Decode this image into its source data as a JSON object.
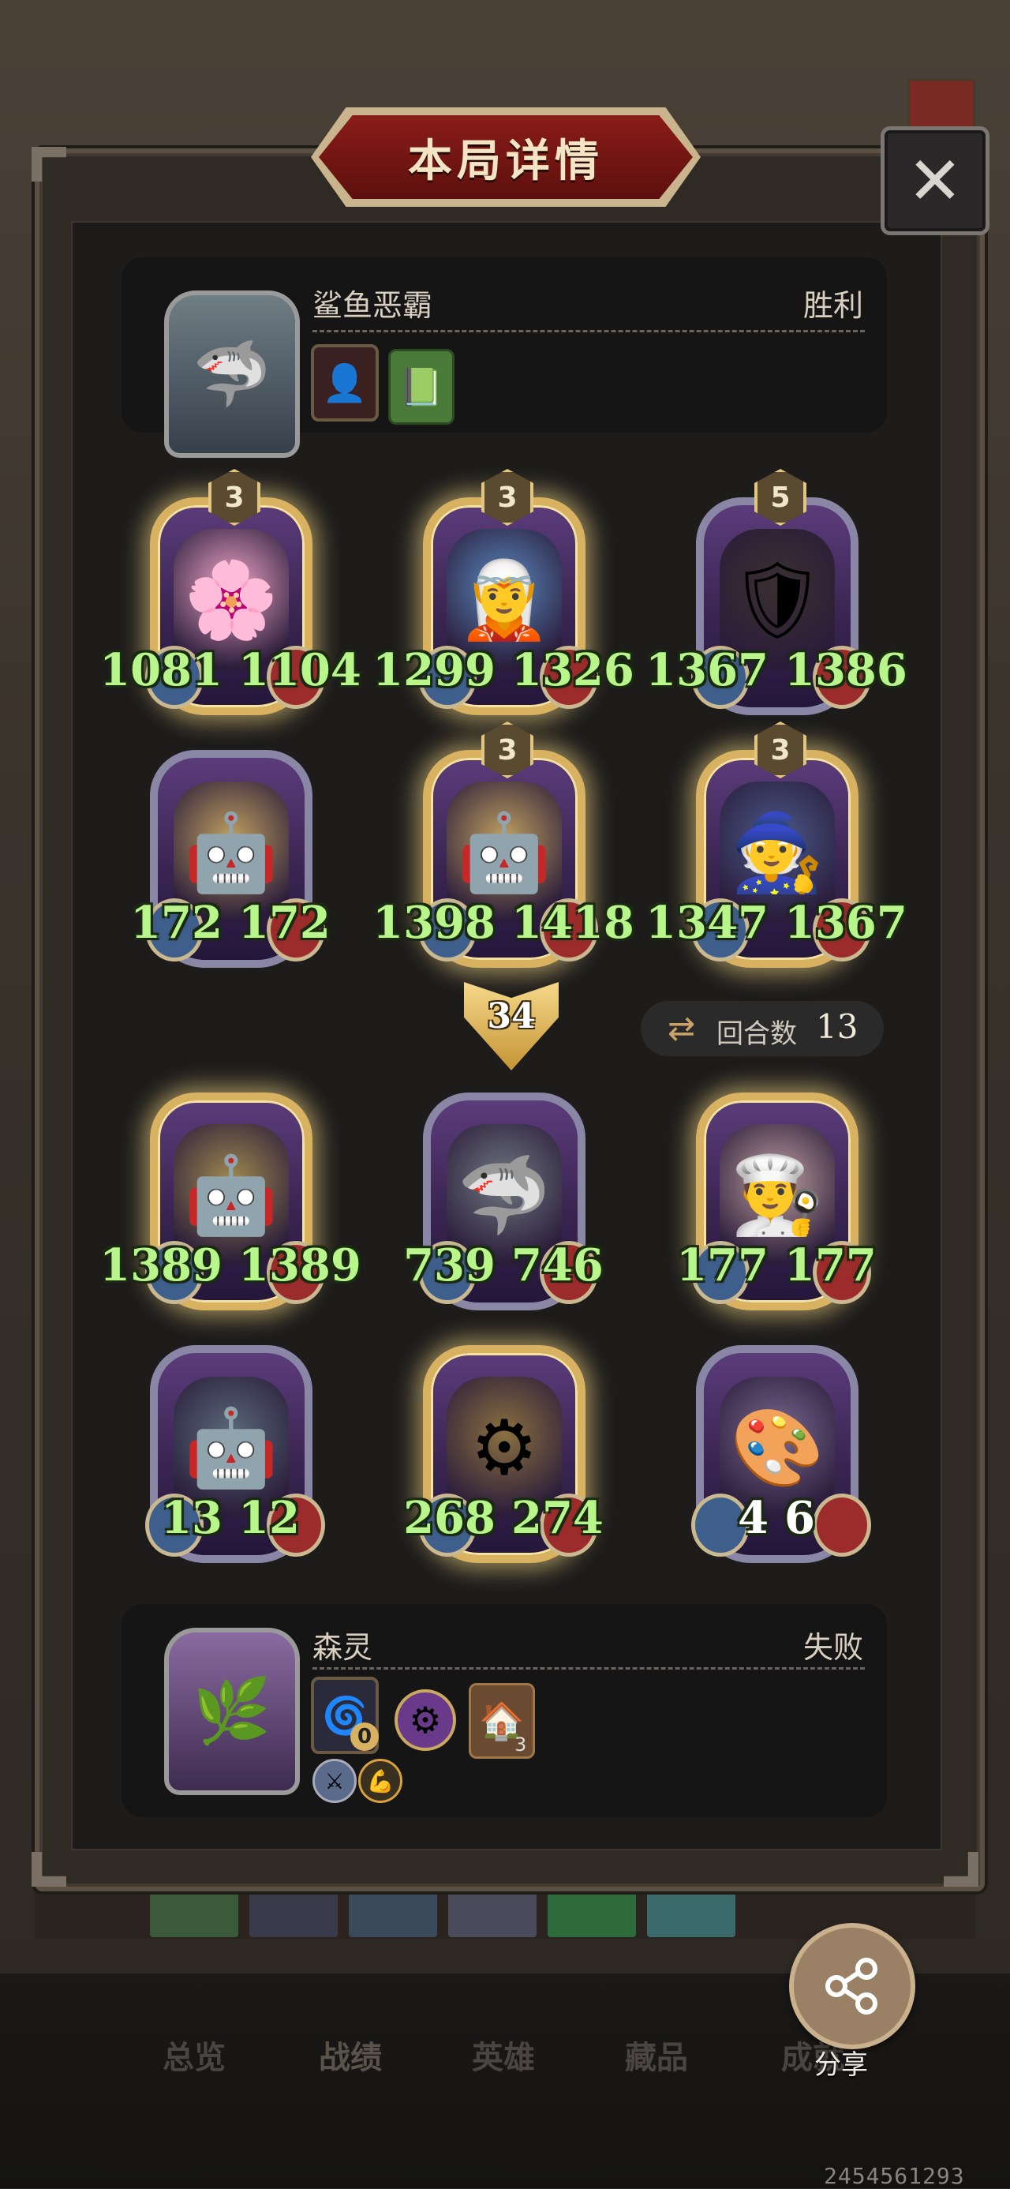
{
  "title": "本局详情",
  "close_icon": "close-icon",
  "opponent": {
    "name": "鲨鱼恶霸",
    "result": "胜利",
    "avatar_icon": "shark-hero-portrait",
    "items": [
      "shadow-card-icon",
      "spellbook-icon"
    ]
  },
  "opponent_board": [
    {
      "attack": "1081",
      "health": "1104",
      "tier": "3",
      "golden": true,
      "art": "flower-girl"
    },
    {
      "attack": "1299",
      "health": "1326",
      "tier": "3",
      "golden": true,
      "art": "elf-sorceress"
    },
    {
      "attack": "1367",
      "health": "1386",
      "tier": "5",
      "golden": false,
      "art": "shield-knight"
    },
    {
      "attack": "172",
      "health": "172",
      "tier": "",
      "golden": false,
      "art": "robot-doll"
    },
    {
      "attack": "1398",
      "health": "1418",
      "tier": "3",
      "golden": true,
      "art": "robot-doll"
    },
    {
      "attack": "1347",
      "health": "1367",
      "tier": "3",
      "golden": true,
      "art": "wizard"
    }
  ],
  "damage": "34",
  "round": {
    "label": "回合数",
    "value": "13"
  },
  "player_board": [
    {
      "attack": "1389",
      "health": "1389",
      "golden": true,
      "art": "laser-robot"
    },
    {
      "attack": "739",
      "health": "746",
      "golden": false,
      "art": "shark-beast"
    },
    {
      "attack": "177",
      "health": "177",
      "golden": true,
      "art": "old-chef"
    },
    {
      "attack": "13",
      "health": "12",
      "golden": false,
      "art": "thinking-robot"
    },
    {
      "attack": "268",
      "health": "274",
      "golden": true,
      "art": "steam-submarine"
    },
    {
      "attack": "4",
      "health": "6",
      "golden": false,
      "art": "wind-up-painter",
      "white_stats": true
    }
  ],
  "player": {
    "name": "森灵",
    "result": "失败",
    "avatar_icon": "forest-spirit-portrait",
    "items": [
      {
        "icon": "shadow-portal-icon",
        "badge": "0"
      },
      {
        "icon": "purple-coin-icon",
        "badge": ""
      },
      {
        "icon": "wooden-house-icon",
        "badge": "3"
      }
    ],
    "small_icons": [
      "sword-skill-icon",
      "gold-skill-icon"
    ]
  },
  "bottom_nav": [
    "总览",
    "战绩",
    "英雄",
    "藏品",
    "成就"
  ],
  "share_label": "分享",
  "uid": "2454561293",
  "colors": {
    "stat_green": "#b8f58a",
    "gold_frame": "#d8b260",
    "title_red": "#8a1c18"
  }
}
